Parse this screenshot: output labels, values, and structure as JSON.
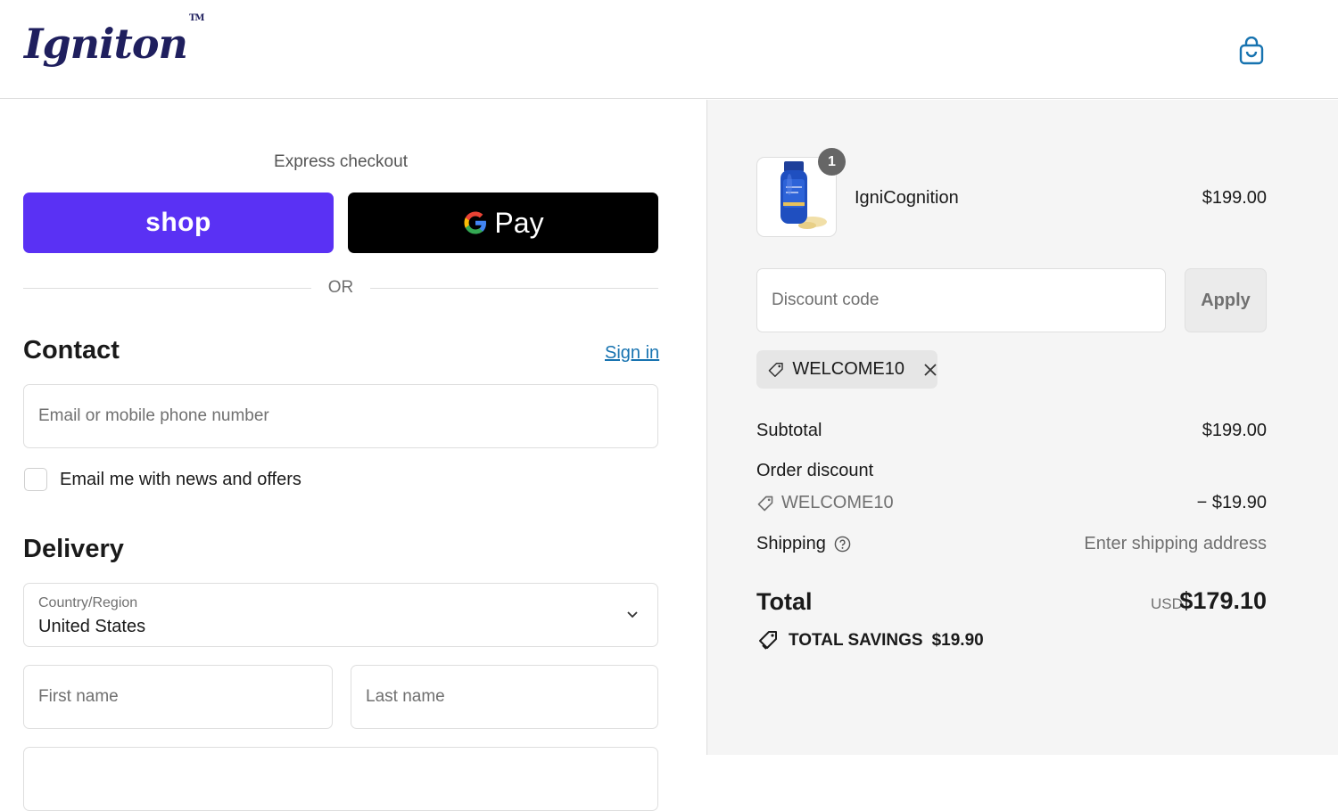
{
  "header": {
    "logo": "Igniton",
    "logo_mark": "TM",
    "cart_icon": "shopping-bag-icon"
  },
  "express": {
    "label": "Express checkout",
    "shop_label": "shop",
    "gpay_label": "Pay",
    "or_label": "OR"
  },
  "contact": {
    "title": "Contact",
    "sign_in": "Sign in",
    "email_placeholder": "Email or mobile phone number",
    "newsletter_label": "Email me with news and offers",
    "newsletter_checked": false
  },
  "delivery": {
    "title": "Delivery",
    "country_label": "Country/Region",
    "country_value": "United States",
    "first_name_placeholder": "First name",
    "last_name_placeholder": "Last name"
  },
  "summary": {
    "product": {
      "name": "IgniCognition",
      "price": "$199.00",
      "quantity": "1",
      "image_icon": "product-bottle-icon"
    },
    "discount": {
      "placeholder": "Discount code",
      "apply_label": "Apply",
      "applied_code": "WELCOME10"
    },
    "subtotal_label": "Subtotal",
    "subtotal_value": "$199.00",
    "order_discount_label": "Order discount",
    "order_discount_code": "WELCOME10",
    "order_discount_value": "− $19.90",
    "shipping_label": "Shipping",
    "shipping_value": "Enter shipping address",
    "total_label": "Total",
    "total_currency": "USD",
    "total_value": "$179.10",
    "savings_label": "TOTAL SAVINGS",
    "savings_value": "$19.90"
  },
  "colors": {
    "shop_purple": "#5a31f4",
    "link_blue": "#1773b0",
    "logo_navy": "#1f1f5e"
  }
}
